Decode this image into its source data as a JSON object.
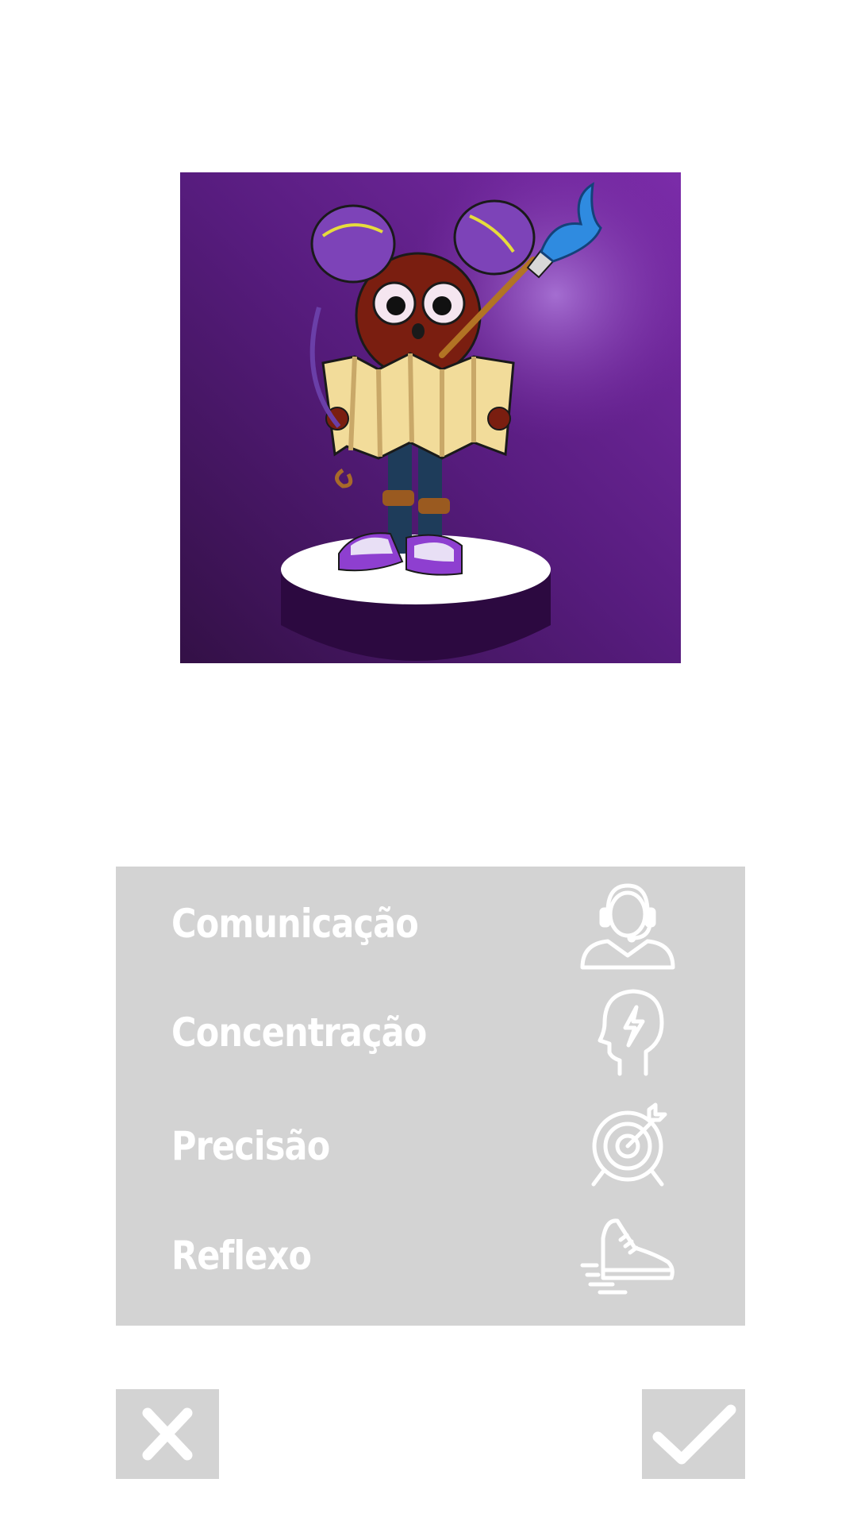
{
  "character": {
    "image_icon": "character-portrait",
    "background_colors": [
      "#3a1250",
      "#7b2aa8"
    ],
    "pedestal_color": "#2e0a45"
  },
  "skills": [
    {
      "label": "Comunicação",
      "icon": "headset-agent-icon"
    },
    {
      "label": "Concentração",
      "icon": "head-lightning-icon"
    },
    {
      "label": "Precisão",
      "icon": "target-arrow-icon"
    },
    {
      "label": "Reflexo",
      "icon": "running-shoe-icon"
    }
  ],
  "actions": {
    "cancel_icon": "close-icon",
    "confirm_icon": "checkmark-icon"
  },
  "colors": {
    "panel": "#d3d3d3",
    "text": "#ffffff",
    "background": "#ffffff"
  }
}
